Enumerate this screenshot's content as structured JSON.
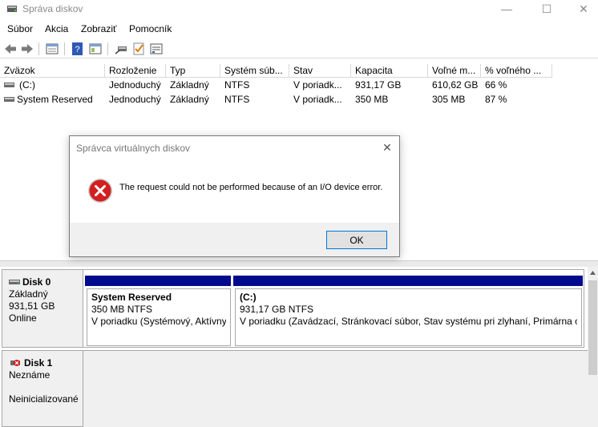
{
  "window": {
    "title": "Správa diskov"
  },
  "window_controls": {
    "minimize": "—",
    "maximize": "☐",
    "close": "✕"
  },
  "menu": {
    "items": [
      "Súbor",
      "Akcia",
      "Zobraziť",
      "Pomocník"
    ]
  },
  "volume_table": {
    "headers": [
      "Zväzok",
      "Rozloženie",
      "Typ",
      "Systém súb...",
      "Stav",
      "Kapacita",
      "Voľné m...",
      "% voľného ..."
    ],
    "rows": [
      [
        "(C:)",
        "Jednoduchý",
        "Základný",
        "NTFS",
        "V poriadk...",
        "931,17 GB",
        "610,62 GB",
        "66 %"
      ],
      [
        "System Reserved",
        "Jednoduchý",
        "Základný",
        "NTFS",
        "V poriadk...",
        "350 MB",
        "305 MB",
        "87 %"
      ]
    ]
  },
  "disks": [
    {
      "name": "Disk 0",
      "type": "Základný",
      "size": "931,51 GB",
      "status": "Online",
      "partitions": [
        {
          "name": "System Reserved",
          "size": "350 MB NTFS",
          "status": "V poriadku (Systémový, Aktívny,"
        },
        {
          "name": "(C:)",
          "size": "931,17 GB NTFS",
          "status": "V poriadku (Zavádzací, Stránkovací súbor, Stav systému pri zlyhaní, Primárna obl"
        }
      ]
    },
    {
      "name": "Disk 1",
      "type": "Neznáme",
      "status": "Neinicializované"
    }
  ],
  "dialog": {
    "title": "Správca virtuálnych diskov",
    "message": "The request could not be performed because of an I/O device error.",
    "ok_label": "OK",
    "close_glyph": "✕"
  },
  "colors": {
    "partition_bar": "#000a8c",
    "error_red": "#d21f1f",
    "accent": "#0078d7"
  }
}
